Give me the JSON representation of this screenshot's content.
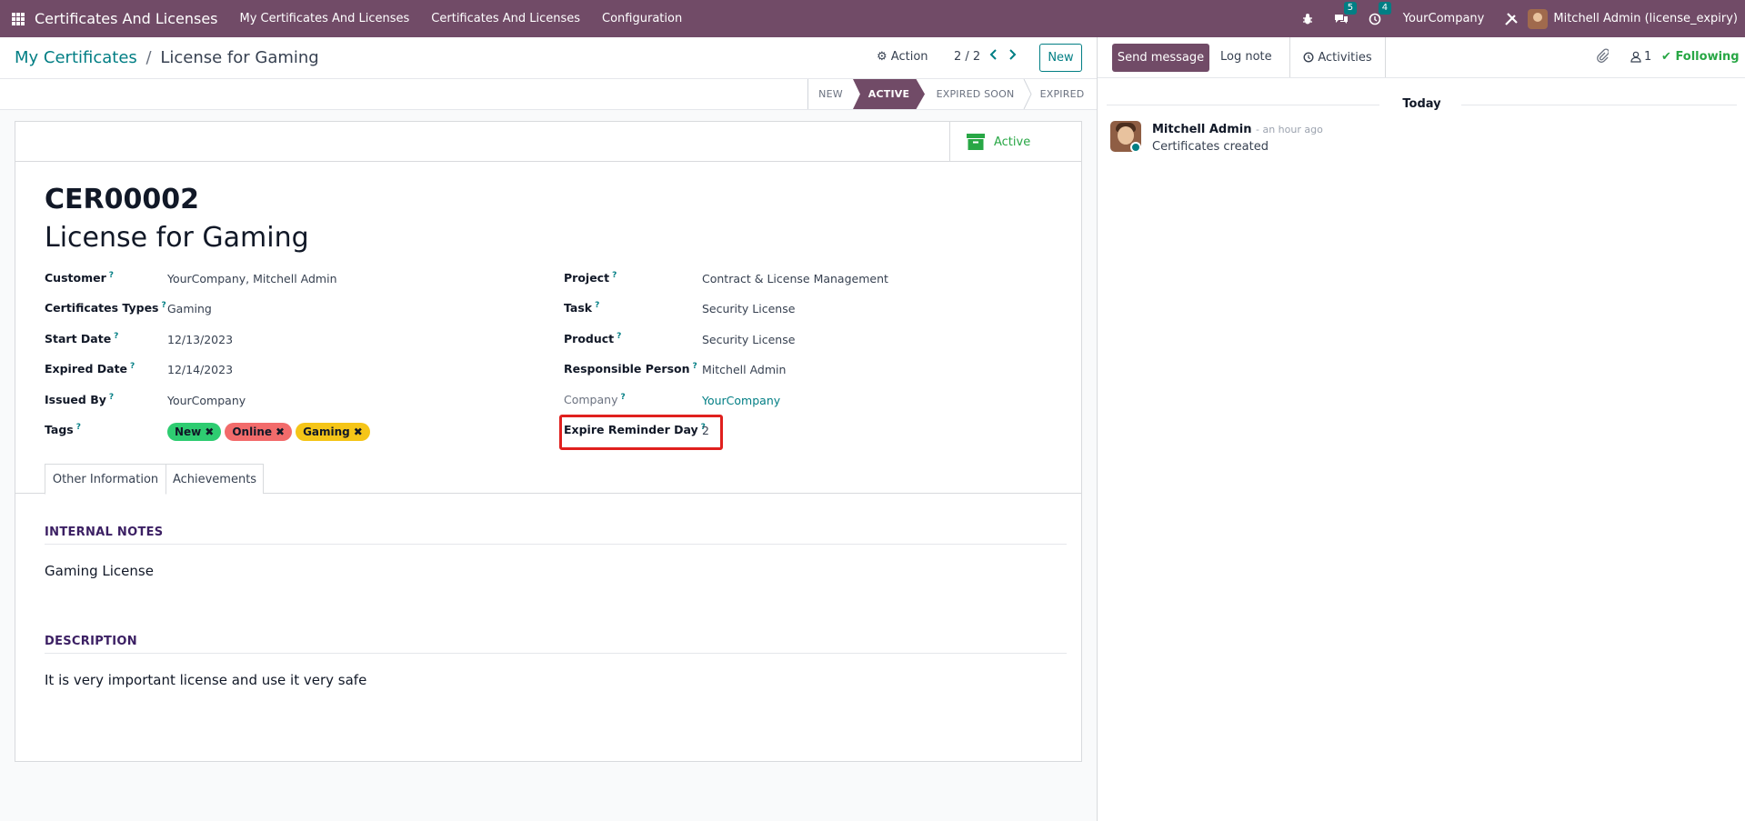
{
  "navbar": {
    "app_title": "Certificates And Licenses",
    "menu": [
      "My Certificates And Licenses",
      "Certificates And Licenses",
      "Configuration"
    ],
    "messages_count": "5",
    "activities_count": "4",
    "company": "YourCompany",
    "user": "Mitchell Admin (license_expiry)"
  },
  "control": {
    "breadcrumb_parent": "My Certificates",
    "breadcrumb_sep": "/",
    "breadcrumb_current": "License for Gaming",
    "action_label": "Action",
    "pager": "2 / 2",
    "new_label": "New"
  },
  "statusbar": {
    "stages": [
      "NEW",
      "ACTIVE",
      "EXPIRED SOON",
      "EXPIRED"
    ],
    "current": "ACTIVE"
  },
  "form": {
    "active_button": "Active",
    "reference": "CER00002",
    "name": "License for Gaming",
    "left_fields": [
      {
        "label": "Customer",
        "value": "YourCompany, Mitchell Admin"
      },
      {
        "label": "Certificates Types",
        "value": "Gaming"
      },
      {
        "label": "Start Date",
        "value": "12/13/2023"
      },
      {
        "label": "Expired Date",
        "value": "12/14/2023"
      },
      {
        "label": "Issued By",
        "value": "YourCompany"
      },
      {
        "label": "Tags",
        "value": ""
      }
    ],
    "right_fields": [
      {
        "label": "Project",
        "value": "Contract & License Management"
      },
      {
        "label": "Task",
        "value": "Security License"
      },
      {
        "label": "Product",
        "value": "Security License"
      },
      {
        "label": "Responsible Person",
        "value": "Mitchell Admin"
      },
      {
        "label": "Company",
        "value": "YourCompany"
      },
      {
        "label": "Expire Reminder Day",
        "value": "2"
      }
    ],
    "tags": [
      {
        "label": "New",
        "color": "#2ecc71"
      },
      {
        "label": "Online",
        "color": "#f26b6b"
      },
      {
        "label": "Gaming",
        "color": "#f5c518"
      }
    ],
    "tabs": [
      "Other Information",
      "Achievements"
    ],
    "internal_notes_title": "INTERNAL NOTES",
    "internal_notes": "Gaming License",
    "description_title": "DESCRIPTION",
    "description": "It is very important license and use it very safe"
  },
  "chatter": {
    "send_message": "Send message",
    "log_note": "Log note",
    "activities": "Activities",
    "followers_count": "1",
    "following": "Following",
    "date_divider": "Today",
    "messages": [
      {
        "author": "Mitchell Admin",
        "time": "- an hour ago",
        "body": "Certificates created"
      }
    ]
  },
  "colors": {
    "brand": "#714b67",
    "accent": "#017e84",
    "success": "#28a745",
    "highlight": "#e0201e"
  }
}
